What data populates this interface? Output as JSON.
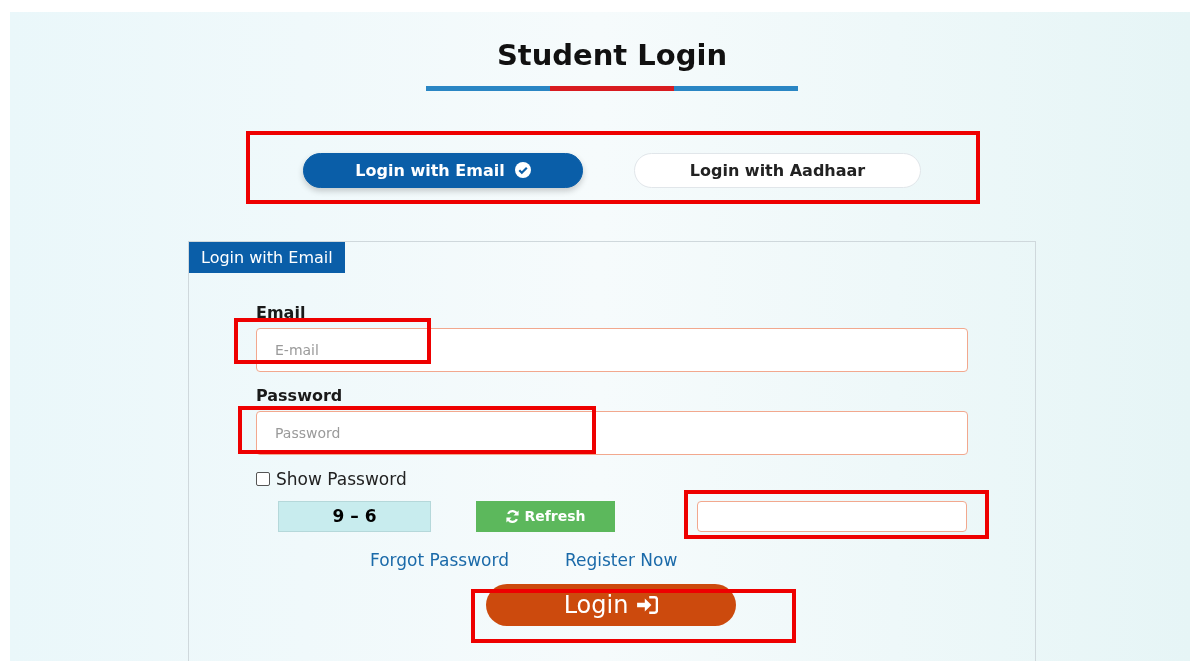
{
  "title": "Student Login",
  "mode_tabs": {
    "highlighted": true,
    "tabs": [
      {
        "label": "Login with Email",
        "selected": true
      },
      {
        "label": "Login with Aadhaar",
        "selected": false
      }
    ]
  },
  "form": {
    "legend": "Login with Email",
    "email": {
      "label": "Email",
      "placeholder": "E-mail",
      "highlighted": true
    },
    "password": {
      "label": "Password",
      "placeholder": "Password",
      "highlighted": true
    },
    "show_password": {
      "label": "Show Password",
      "checked": false
    },
    "captcha": {
      "question": "9 – 6",
      "refresh_label": "Refresh",
      "highlighted": true
    },
    "links": [
      "Forgot Password",
      "Register Now"
    ],
    "login_button": {
      "label": "Login",
      "highlighted": true
    }
  }
}
